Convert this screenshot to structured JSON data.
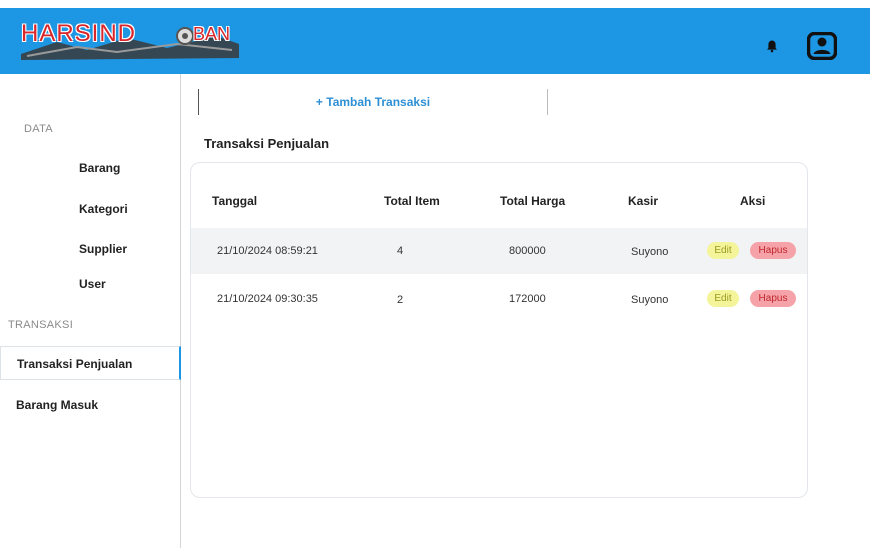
{
  "header": {
    "logo_main": "HARSIND",
    "logo_sub": "BAN",
    "bell_icon": "bell-icon",
    "profile_icon": "user-icon"
  },
  "sidebar": {
    "data_label": "DATA",
    "items_data": [
      "Barang",
      "Kategori",
      "Supplier",
      "User"
    ],
    "transaksi_label": "TRANSAKSI",
    "items_transaksi": [
      "Transaksi Penjualan",
      "Barang Masuk"
    ],
    "active": "Transaksi Penjualan"
  },
  "main": {
    "add_button": "+ Tambah Transaksi",
    "section_title": "Transaksi Penjualan",
    "table": {
      "headers": [
        "Tanggal",
        "Total Item",
        "Total Harga",
        "Kasir",
        "Aksi"
      ],
      "rows": [
        {
          "tanggal": "21/10/2024 08:59:21",
          "total_item": "4",
          "total_harga": "800000",
          "kasir": "Suyono",
          "edit": "Edit",
          "hapus": "Hapus"
        },
        {
          "tanggal": "21/10/2024 09:30:35",
          "total_item": "2",
          "total_harga": "172000",
          "kasir": "Suyono",
          "edit": "Edit",
          "hapus": "Hapus"
        }
      ]
    }
  },
  "colors": {
    "header_bg": "#1d96e3",
    "accent": "#2d8fd5",
    "edit_bg": "#f4f49a",
    "hapus_bg": "#f5a3a8",
    "row_alt": "#f1f3f5"
  }
}
